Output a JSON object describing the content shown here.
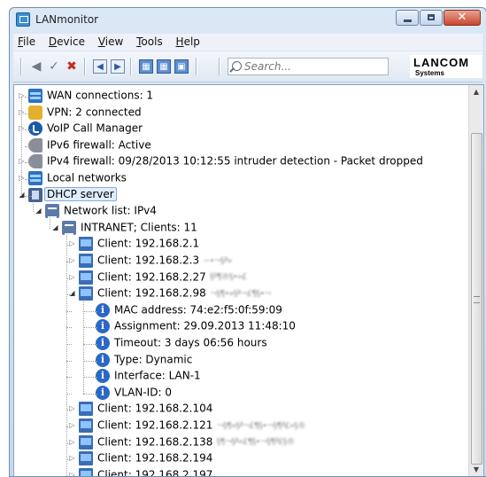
{
  "window": {
    "title": "LANmonitor",
    "buttons": {
      "minimize": "minimize",
      "maximize": "maximize",
      "close": "✕"
    }
  },
  "menu": [
    {
      "label": "File",
      "u": "F",
      "rest": "ile"
    },
    {
      "label": "Device",
      "u": "D",
      "rest": "evice"
    },
    {
      "label": "View",
      "u": "V",
      "rest": "iew"
    },
    {
      "label": "Tools",
      "u": "T",
      "rest": "ools"
    },
    {
      "label": "Help",
      "u": "H",
      "rest": "elp"
    }
  ],
  "toolbar": {
    "search_placeholder": "Search...",
    "logo": {
      "main": "LANCOM",
      "sub": "Systems"
    },
    "icons": [
      "add-device-icon",
      "check-device-icon",
      "remove-device-icon",
      "back-icon",
      "forward-icon",
      "device-info-icon",
      "grid-view-icon",
      "save-icon"
    ]
  },
  "tree": {
    "nodes": [
      {
        "label": "WAN connections: 1",
        "icon": "network-icon",
        "expander": "collapsed"
      },
      {
        "label": "VPN: 2 connected",
        "icon": "lock-icon",
        "expander": "collapsed"
      },
      {
        "label": "VoIP Call Manager",
        "icon": "voip-icon",
        "expander": "collapsed"
      },
      {
        "label": "IPv6 firewall: Active",
        "icon": "firewall-icon",
        "expander": "none"
      },
      {
        "label": "IPv4 firewall: 09/28/2013 10:12:55 intruder detection - Packet dropped",
        "icon": "firewall-icon",
        "expander": "collapsed"
      },
      {
        "label": "Local networks",
        "icon": "network-icon",
        "expander": "collapsed"
      },
      {
        "label": "DHCP server",
        "icon": "dhcp-server-icon",
        "expander": "expanded",
        "selected": true
      },
      {
        "label": "Network list: IPv4",
        "icon": "network-list-icon",
        "expander": "expanded"
      },
      {
        "label": "INTRANET; Clients: 11",
        "icon": "network-list-icon",
        "expander": "expanded"
      },
      {
        "label": "Client: 192.168.2.1",
        "icon": "client-icon",
        "expander": "collapsed"
      },
      {
        "label": "Client: 192.168.2.3",
        "icon": "client-icon",
        "expander": "collapsed",
        "obscured": "~•¬§ª»"
      },
      {
        "label": "Client: 192.168.2.27",
        "icon": "client-icon",
        "expander": "collapsed",
        "obscured": "§º¶®§•»£"
      },
      {
        "label": "Client: 192.168.2.98",
        "icon": "client-icon",
        "expander": "expanded",
        "obscured": "¬§¶•»§ª¬£¶§•¬"
      },
      {
        "label": "MAC address: 74:e2:f5:0f:59:09",
        "icon": "info-icon",
        "expander": "none"
      },
      {
        "label": "Assignment: 29.09.2013 11:48:10",
        "icon": "info-icon",
        "expander": "none"
      },
      {
        "label": "Timeout: 3 days 06:56 hours",
        "icon": "info-icon",
        "expander": "none"
      },
      {
        "label": "Type: Dynamic",
        "icon": "info-icon",
        "expander": "none"
      },
      {
        "label": "Interface: LAN-1",
        "icon": "info-icon",
        "expander": "none"
      },
      {
        "label": "VLAN-ID: 0",
        "icon": "info-icon",
        "expander": "none"
      },
      {
        "label": "Client: 192.168.2.104",
        "icon": "client-icon",
        "expander": "collapsed"
      },
      {
        "label": "Client: 192.168.2.121",
        "icon": "client-icon",
        "expander": "collapsed",
        "obscured": "¬§¶«§ª¬£¶§•¬§¶ª£»§®"
      },
      {
        "label": "Client: 192.168.2.138",
        "icon": "client-icon",
        "expander": "collapsed",
        "obscured": "§¶¬§ª«£¶§•¬§¶ª£§®"
      },
      {
        "label": "Client: 192.168.2.194",
        "icon": "client-icon",
        "expander": "collapsed"
      },
      {
        "label": "Client: 192.168.2.197",
        "icon": "client-icon",
        "expander": "collapsed"
      }
    ]
  }
}
